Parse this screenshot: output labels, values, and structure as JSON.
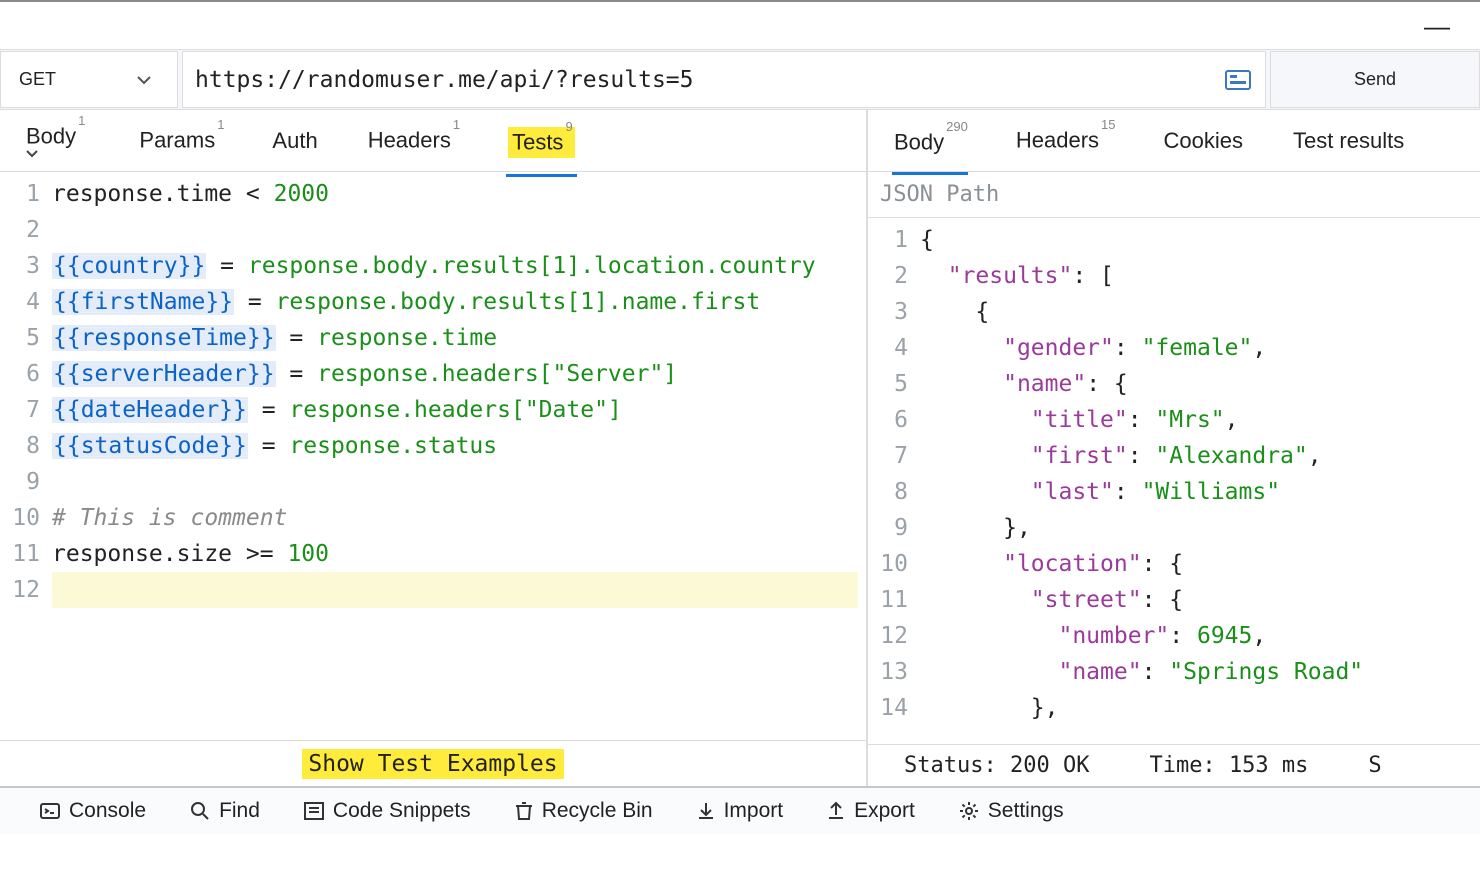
{
  "titlebar": {
    "minimize_glyph": "—"
  },
  "request": {
    "method": "GET",
    "url": "https://randomuser.me/api/?results=5",
    "send_label": "Send"
  },
  "req_tabs": [
    {
      "label": "Body",
      "badge": "1",
      "id": "body",
      "chevron": true
    },
    {
      "label": "Params",
      "badge": "1",
      "id": "params"
    },
    {
      "label": "Auth",
      "badge": "",
      "id": "auth"
    },
    {
      "label": "Headers",
      "badge": "1",
      "id": "headers"
    },
    {
      "label": "Tests",
      "badge": "9",
      "id": "tests",
      "active": true,
      "hl": true
    }
  ],
  "resp_tabs": [
    {
      "label": "Body",
      "badge": "290",
      "id": "body",
      "active": true
    },
    {
      "label": "Headers",
      "badge": "15",
      "id": "headers"
    },
    {
      "label": "Cookies",
      "badge": "",
      "id": "cookies"
    },
    {
      "label": "Test results",
      "badge": "",
      "id": "test-results"
    }
  ],
  "tests_code": {
    "lines": [
      {
        "n": 1,
        "t": [
          [
            "ident",
            "response.time "
          ],
          [
            "op",
            "<"
          ],
          [
            "ident",
            " "
          ],
          [
            "num",
            "2000"
          ]
        ]
      },
      {
        "n": 2,
        "t": []
      },
      {
        "n": 3,
        "t": [
          [
            "var",
            "{{country}}"
          ],
          [
            "ident",
            " = "
          ],
          [
            "path",
            "response.body.results[1].location.country"
          ]
        ]
      },
      {
        "n": 4,
        "t": [
          [
            "var",
            "{{firstName}}"
          ],
          [
            "ident",
            " = "
          ],
          [
            "path",
            "response.body.results[1].name.first"
          ]
        ]
      },
      {
        "n": 5,
        "t": [
          [
            "var",
            "{{responseTime}}"
          ],
          [
            "ident",
            " = "
          ],
          [
            "path",
            "response.time"
          ]
        ]
      },
      {
        "n": 6,
        "t": [
          [
            "var",
            "{{serverHeader}}"
          ],
          [
            "ident",
            " = "
          ],
          [
            "path",
            "response.headers["
          ],
          [
            "str",
            "\"Server\""
          ],
          [
            "path",
            "]"
          ]
        ]
      },
      {
        "n": 7,
        "t": [
          [
            "var",
            "{{dateHeader}}"
          ],
          [
            "ident",
            " = "
          ],
          [
            "path",
            "response.headers["
          ],
          [
            "str",
            "\"Date\""
          ],
          [
            "path",
            "]"
          ]
        ]
      },
      {
        "n": 8,
        "t": [
          [
            "var",
            "{{statusCode}}"
          ],
          [
            "ident",
            " = "
          ],
          [
            "path",
            "response.status"
          ]
        ]
      },
      {
        "n": 9,
        "t": []
      },
      {
        "n": 10,
        "t": [
          [
            "comment",
            "# This is comment"
          ]
        ]
      },
      {
        "n": 11,
        "t": [
          [
            "ident",
            "response.size "
          ],
          [
            "op",
            ">="
          ],
          [
            "ident",
            " "
          ],
          [
            "num",
            "100"
          ]
        ]
      },
      {
        "n": 12,
        "t": [],
        "cursor": true
      }
    ]
  },
  "show_examples_label": "Show Test Examples",
  "json_path_placeholder": "JSON Path",
  "response_json": {
    "lines": [
      {
        "n": 1,
        "indent": 0,
        "t": [
          [
            "bracket",
            "{"
          ]
        ]
      },
      {
        "n": 2,
        "indent": 1,
        "t": [
          [
            "key",
            "\"results\""
          ],
          [
            "punct",
            ": "
          ],
          [
            "bracket",
            "["
          ]
        ]
      },
      {
        "n": 3,
        "indent": 2,
        "t": [
          [
            "bracket",
            "{"
          ]
        ]
      },
      {
        "n": 4,
        "indent": 3,
        "t": [
          [
            "key",
            "\"gender\""
          ],
          [
            "punct",
            ": "
          ],
          [
            "str",
            "\"female\""
          ],
          [
            "punct",
            ","
          ]
        ]
      },
      {
        "n": 5,
        "indent": 3,
        "t": [
          [
            "key",
            "\"name\""
          ],
          [
            "punct",
            ": "
          ],
          [
            "bracket",
            "{"
          ]
        ]
      },
      {
        "n": 6,
        "indent": 4,
        "t": [
          [
            "key",
            "\"title\""
          ],
          [
            "punct",
            ": "
          ],
          [
            "str",
            "\"Mrs\""
          ],
          [
            "punct",
            ","
          ]
        ]
      },
      {
        "n": 7,
        "indent": 4,
        "t": [
          [
            "key",
            "\"first\""
          ],
          [
            "punct",
            ": "
          ],
          [
            "str",
            "\"Alexandra\""
          ],
          [
            "punct",
            ","
          ]
        ]
      },
      {
        "n": 8,
        "indent": 4,
        "t": [
          [
            "key",
            "\"last\""
          ],
          [
            "punct",
            ": "
          ],
          [
            "str",
            "\"Williams\""
          ]
        ]
      },
      {
        "n": 9,
        "indent": 3,
        "t": [
          [
            "bracket",
            "}"
          ],
          [
            "punct",
            ","
          ]
        ]
      },
      {
        "n": 10,
        "indent": 3,
        "t": [
          [
            "key",
            "\"location\""
          ],
          [
            "punct",
            ": "
          ],
          [
            "bracket",
            "{"
          ]
        ]
      },
      {
        "n": 11,
        "indent": 4,
        "t": [
          [
            "key",
            "\"street\""
          ],
          [
            "punct",
            ": "
          ],
          [
            "bracket",
            "{"
          ]
        ]
      },
      {
        "n": 12,
        "indent": 5,
        "t": [
          [
            "key",
            "\"number\""
          ],
          [
            "punct",
            ": "
          ],
          [
            "num",
            "6945"
          ],
          [
            "punct",
            ","
          ]
        ]
      },
      {
        "n": 13,
        "indent": 5,
        "t": [
          [
            "key",
            "\"name\""
          ],
          [
            "punct",
            ": "
          ],
          [
            "str",
            "\"Springs Road\""
          ]
        ]
      },
      {
        "n": 14,
        "indent": 4,
        "t": [
          [
            "bracket",
            "}"
          ],
          [
            "punct",
            ","
          ]
        ]
      }
    ]
  },
  "status_line": {
    "status_label": "Status:",
    "status_value": "200 OK",
    "time_label": "Time:",
    "time_value": "153 ms",
    "size_label": "S"
  },
  "bottombar": [
    {
      "id": "console",
      "label": "Console",
      "icon": "console"
    },
    {
      "id": "find",
      "label": "Find",
      "icon": "search"
    },
    {
      "id": "snippets",
      "label": "Code Snippets",
      "icon": "list"
    },
    {
      "id": "recycle",
      "label": "Recycle Bin",
      "icon": "trash"
    },
    {
      "id": "import",
      "label": "Import",
      "icon": "download"
    },
    {
      "id": "export",
      "label": "Export",
      "icon": "upload"
    },
    {
      "id": "settings",
      "label": "Settings",
      "icon": "gear"
    }
  ]
}
